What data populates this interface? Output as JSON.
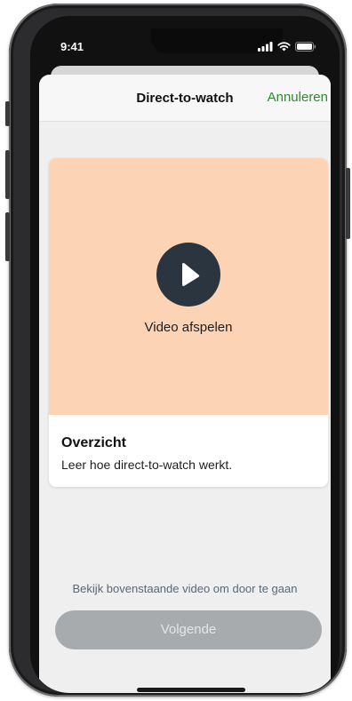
{
  "status_bar": {
    "time": "9:41"
  },
  "nav": {
    "title": "Direct-to-watch",
    "cancel_label": "Annuleren"
  },
  "video": {
    "play_label": "Video afspelen"
  },
  "card": {
    "title": "Overzicht",
    "subtitle": "Leer hoe direct-to-watch werkt."
  },
  "footer": {
    "hint": "Bekijk bovenstaande video om door te gaan",
    "next_label": "Volgende"
  },
  "colors": {
    "accent": "#2e8b2e",
    "video_bg": "#fcd3b5",
    "play_button": "#2b3540",
    "disabled_button": "#a8abae"
  }
}
